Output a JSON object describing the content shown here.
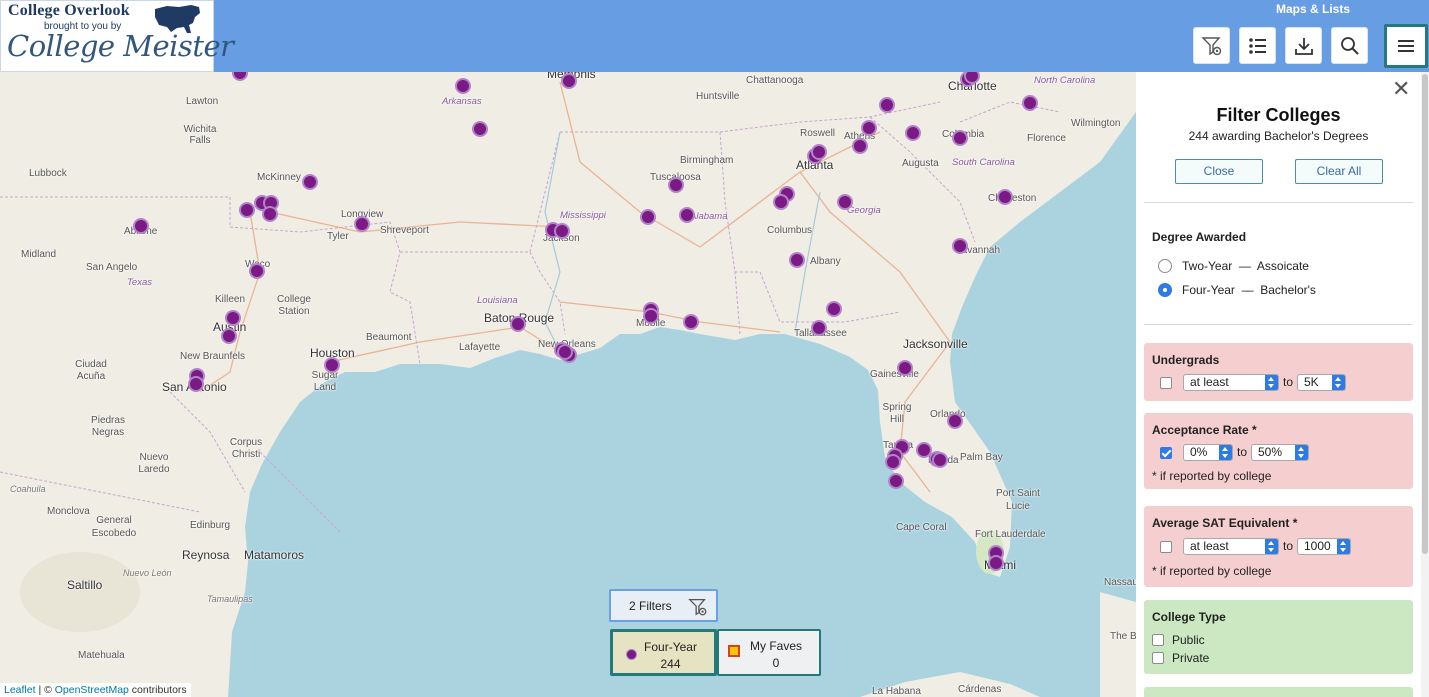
{
  "header": {
    "logo_title": "College Overlook",
    "logo_subtitle": "brought to you by",
    "logo_brand": "College Meister",
    "maps_lists_label": "Maps & Lists"
  },
  "toolbar": {
    "icons": [
      "filter-settings-icon",
      "list-icon",
      "download-icon",
      "search-icon",
      "menu-icon"
    ],
    "accent_color": "#237a7a",
    "header_color": "#679ee3"
  },
  "map": {
    "marker_color": "#7b1a84",
    "places": [
      {
        "name": "Memphis"
      },
      {
        "name": "Chattanooga"
      },
      {
        "name": "Charlotte"
      },
      {
        "name": "North Carolina"
      },
      {
        "name": "Lawton"
      },
      {
        "name": "Arkansas"
      },
      {
        "name": "Huntsville"
      },
      {
        "name": "Wichita Falls"
      },
      {
        "name": "Roswell"
      },
      {
        "name": "Athens"
      },
      {
        "name": "Columbia"
      },
      {
        "name": "Florence"
      },
      {
        "name": "Wilmington"
      },
      {
        "name": "Lubbock"
      },
      {
        "name": "McKinney"
      },
      {
        "name": "Birmingham"
      },
      {
        "name": "Atlanta"
      },
      {
        "name": "Augusta"
      },
      {
        "name": "South Carolina"
      },
      {
        "name": "Tuscaloosa"
      },
      {
        "name": "Charleston"
      },
      {
        "name": "Abilene"
      },
      {
        "name": "Longview"
      },
      {
        "name": "Tyler"
      },
      {
        "name": "Shreveport"
      },
      {
        "name": "Mississippi"
      },
      {
        "name": "Alabama"
      },
      {
        "name": "Georgia"
      },
      {
        "name": "Midland"
      },
      {
        "name": "Jackson"
      },
      {
        "name": "Columbus"
      },
      {
        "name": "Savannah"
      },
      {
        "name": "San Angelo"
      },
      {
        "name": "Waco"
      },
      {
        "name": "Albany"
      },
      {
        "name": "Texas"
      },
      {
        "name": "Killeen"
      },
      {
        "name": "College Station"
      },
      {
        "name": "Louisiana"
      },
      {
        "name": "Baton Rouge"
      },
      {
        "name": "Mobile"
      },
      {
        "name": "Tallahassee"
      },
      {
        "name": "Austin"
      },
      {
        "name": "Beaumont"
      },
      {
        "name": "Lafayette"
      },
      {
        "name": "New Orleans"
      },
      {
        "name": "Jacksonville"
      },
      {
        "name": "Houston"
      },
      {
        "name": "New Braunfels"
      },
      {
        "name": "Ciudad Acuña"
      },
      {
        "name": "Sugar Land"
      },
      {
        "name": "Gainesville"
      },
      {
        "name": "San Antonio"
      },
      {
        "name": "Spring Hill"
      },
      {
        "name": "Orlando"
      },
      {
        "name": "Piedras Negras"
      },
      {
        "name": "Corpus Christi"
      },
      {
        "name": "Tampa"
      },
      {
        "name": "Palm Bay"
      },
      {
        "name": "Nuevo Laredo"
      },
      {
        "name": "Florida"
      },
      {
        "name": "Coahuila"
      },
      {
        "name": "Port Saint Lucie"
      },
      {
        "name": "Monclova"
      },
      {
        "name": "Edinburg"
      },
      {
        "name": "Cape Coral"
      },
      {
        "name": "General Escobedo"
      },
      {
        "name": "Reynosa"
      },
      {
        "name": "Matamoros"
      },
      {
        "name": "Fort Lauderdale"
      },
      {
        "name": "Nuevo León"
      },
      {
        "name": "Miami"
      },
      {
        "name": "Nassau"
      },
      {
        "name": "Saltillo"
      },
      {
        "name": "Tamaulipas"
      },
      {
        "name": "The Baha"
      },
      {
        "name": "Matehuala"
      },
      {
        "name": "Cárdenas"
      },
      {
        "name": "La Habana"
      }
    ],
    "attribution": {
      "leaflet": "Leaflet",
      "sep": " | © ",
      "osm": "OpenStreetMap",
      "rest": " contributors"
    }
  },
  "controls": {
    "filters_label": "2 Filters",
    "legend_four_label": "Four-Year",
    "legend_four_count": "244",
    "legend_faves_label": "My Faves",
    "legend_faves_count": "0"
  },
  "panel": {
    "close_x": "✕",
    "title": "Filter Colleges",
    "count_text": "244 awarding Bachelor's Degrees",
    "close_button": "Close",
    "clear_button": "Clear All",
    "degree": {
      "title": "Degree Awarded",
      "options": [
        {
          "label": "Two-Year  —  Assoicate",
          "selected": false
        },
        {
          "label": "Four-Year  —  Bachelor's",
          "selected": true
        }
      ]
    },
    "undergrads": {
      "title": "Undergrads",
      "checked": false,
      "mode": "at least",
      "to": "to",
      "value": "5K"
    },
    "acceptance": {
      "title": "Acceptance Rate *",
      "checked": true,
      "from": "0%",
      "to": "to",
      "value": "50%",
      "note": "* if reported by college"
    },
    "sat": {
      "title": "Average SAT Equivalent *",
      "checked": false,
      "mode": "at least",
      "to": "to",
      "value": "1000",
      "note": "* if reported by college"
    },
    "college_type": {
      "title": "College Type",
      "options": [
        {
          "label": "Public",
          "checked": false
        },
        {
          "label": "Private",
          "checked": false
        }
      ]
    },
    "pink_color": "#f5cfcf",
    "green_color": "#cbe8c3"
  }
}
